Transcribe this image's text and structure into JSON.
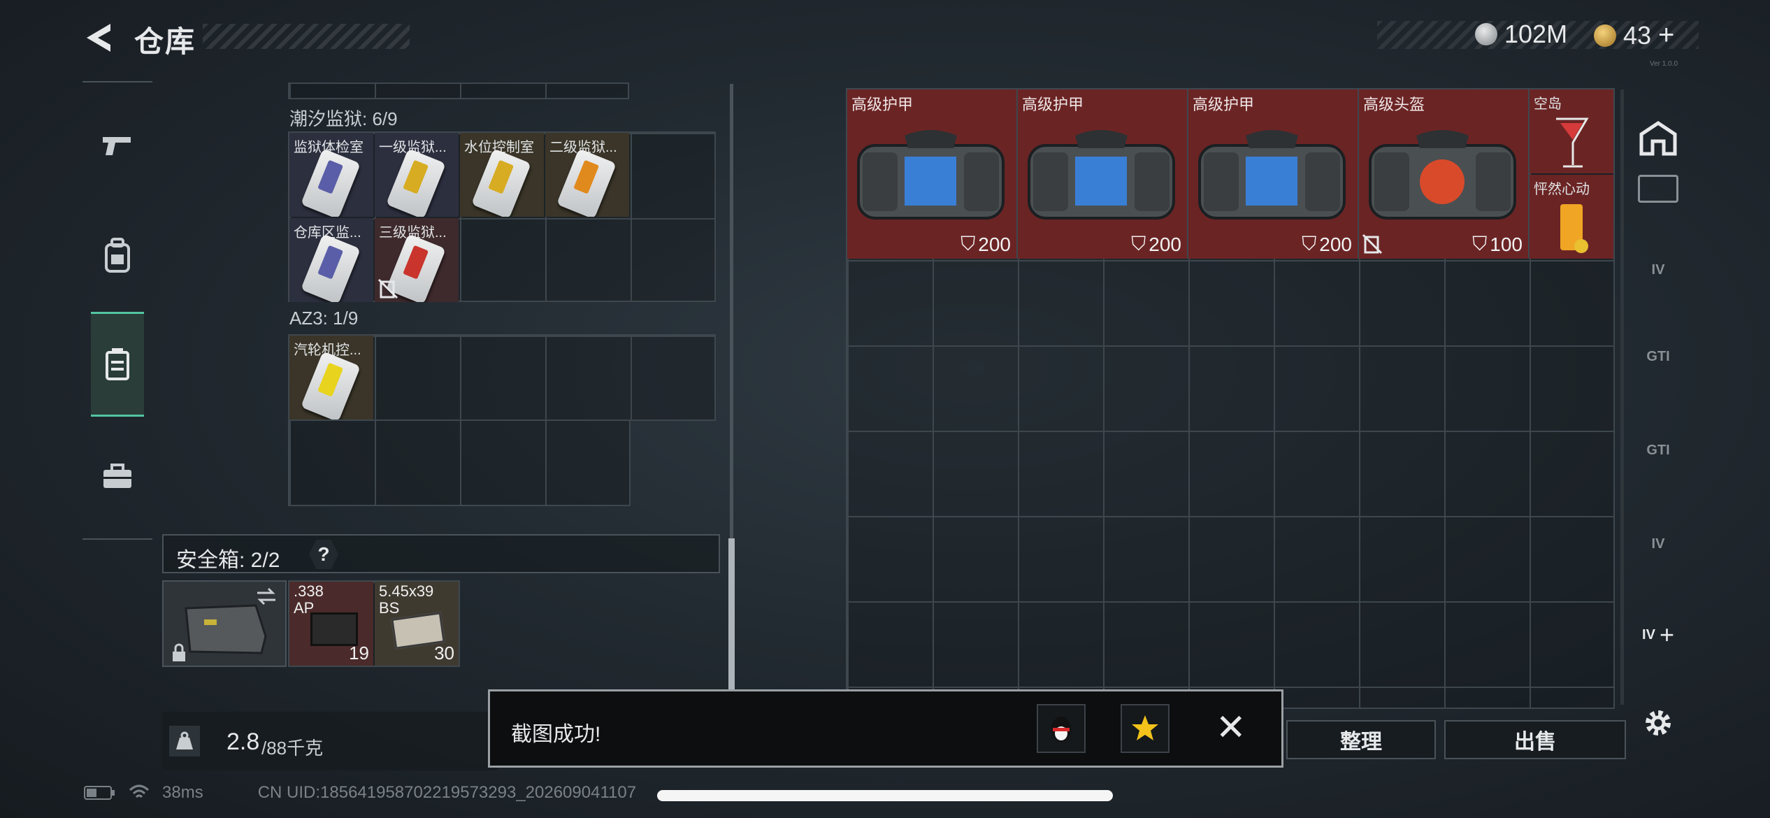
{
  "header": {
    "title": "仓库",
    "currency_silver": "102M",
    "currency_gold": "43",
    "currency_gold_add": "+",
    "tiny_text": "Ver 1.0.0"
  },
  "nav": {
    "items": [
      {
        "name": "weapons",
        "icon": "pistol-icon"
      },
      {
        "name": "equipment",
        "icon": "backpack-icon"
      },
      {
        "name": "storage",
        "icon": "locker-icon",
        "active": true
      },
      {
        "name": "toolbox",
        "icon": "briefcase-icon"
      }
    ]
  },
  "left": {
    "section1": {
      "label": "潮汐监狱: 6/9",
      "items": [
        "监狱体检室",
        "一级监狱...",
        "水位控制室",
        "二级监狱...",
        "仓库区监...",
        "三级监狱..."
      ]
    },
    "section2": {
      "label": "AZ3: 1/9",
      "items": [
        "汽轮机控..."
      ]
    },
    "safe_box": {
      "label": "安全箱: 2/2",
      "help": "?",
      "ammo": [
        {
          "line1": ".338",
          "line2": "AP",
          "count": "19"
        },
        {
          "line1": "5.45x39",
          "line2": "BS",
          "count": "30"
        }
      ]
    },
    "weight": {
      "current": "2.8",
      "max": "/88千克"
    }
  },
  "right": {
    "items": [
      {
        "label": "高级护甲",
        "durability": "200",
        "accent": "#3a7fd6"
      },
      {
        "label": "高级护甲",
        "durability": "200",
        "accent": "#3a7fd6"
      },
      {
        "label": "高级护甲",
        "durability": "200",
        "accent": "#3a7fd6"
      },
      {
        "label": "高级头盔",
        "durability": "100",
        "accent": "#d84a2a"
      }
    ],
    "drinks": [
      {
        "label": "空岛"
      },
      {
        "label": "怦然心动"
      }
    ],
    "side_labels": [
      "IV",
      "GTI",
      "GTI",
      "IV",
      "IV"
    ],
    "buttons": {
      "organize": "整理",
      "sell": "出售"
    }
  },
  "toast": {
    "message": "截图成功!",
    "close": "✕"
  },
  "status": {
    "ping": "38ms",
    "uid": "CN UID:1856419587022195732​93_202609041107"
  }
}
